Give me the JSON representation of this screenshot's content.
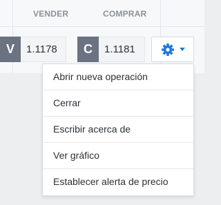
{
  "header": {
    "sell_label": "VENDER",
    "buy_label": "COMPRAR"
  },
  "quote": {
    "sell_letter": "V",
    "sell_price": "1.1178",
    "buy_letter": "C",
    "buy_price": "1.1181"
  },
  "settings_button": {
    "icons": [
      "gear-icon",
      "caret-down-icon"
    ],
    "accent_color": "#1f7bd8"
  },
  "menu": {
    "items": [
      "Abrir nueva operación",
      "Cerrar",
      "Escribir acerca de",
      "Ver gráfico",
      "Establecer alerta de precio"
    ]
  }
}
